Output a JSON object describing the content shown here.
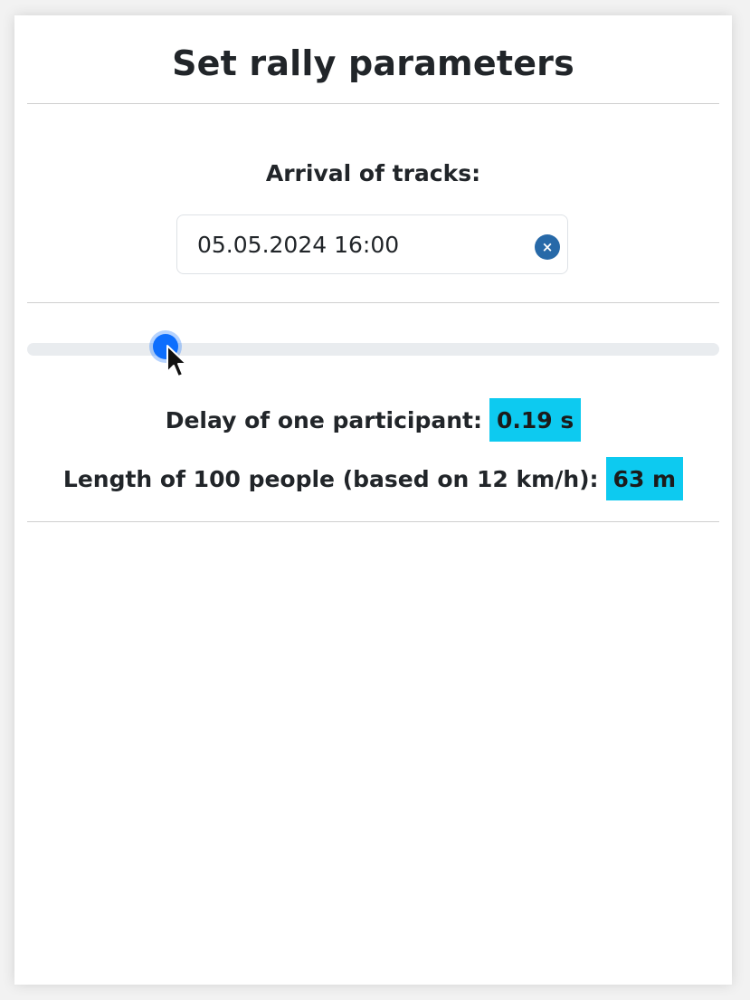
{
  "title": "Set rally parameters",
  "arrival": {
    "label": "Arrival of tracks:",
    "value": "05.05.2024 16:00",
    "clear_icon": "close-icon",
    "clear_glyph": "×"
  },
  "slider": {
    "value_fraction": 0.2
  },
  "stats": {
    "delay_label": "Delay of one participant:",
    "delay_value": "0.19 s",
    "length_label": "Length of 100 people (based on 12 km/h):",
    "length_value": "63 m"
  },
  "colors": {
    "accent": "#0d6efd",
    "badge": "#0dcaf0",
    "clear_button": "#2769a8"
  }
}
